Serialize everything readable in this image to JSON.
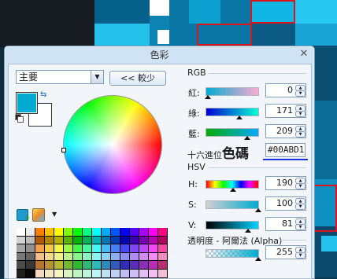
{
  "window": {
    "title": "色彩",
    "close_glyph": "✕"
  },
  "primary_select": {
    "value": "主要"
  },
  "less_button": {
    "label": "<< 較少"
  },
  "colors": {
    "primary": "#00ABD1",
    "secondary": "#FFFFFF"
  },
  "rgb": {
    "header": "RGB",
    "red": {
      "label": "紅:",
      "value": "0"
    },
    "green": {
      "label": "綠:",
      "value": "171"
    },
    "blue": {
      "label": "藍:",
      "value": "209"
    }
  },
  "hex": {
    "label_small": "十六進位",
    "label_big": "色碼",
    "value": "#00ABD1"
  },
  "hsv": {
    "header": "HSV",
    "h": {
      "label": "H:",
      "value": "190"
    },
    "s": {
      "label": "S:",
      "value": "100"
    },
    "v": {
      "label": "V:",
      "value": "81"
    }
  },
  "alpha": {
    "label": "透明度 - 阿爾法 (Alpha)",
    "value": "255"
  },
  "icons": {
    "swap": "swap-colors-icon",
    "reset": "reset-colors-icon",
    "add_palette": "add-palette-color-icon",
    "palette_menu": "palette-menu-icon",
    "dropdown": "chevron-down-icon"
  }
}
